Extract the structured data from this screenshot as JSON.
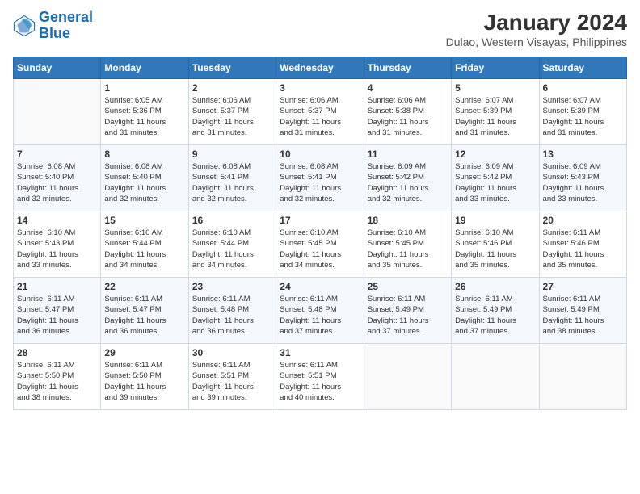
{
  "logo": {
    "line1": "General",
    "line2": "Blue"
  },
  "title": "January 2024",
  "subtitle": "Dulao, Western Visayas, Philippines",
  "weekdays": [
    "Sunday",
    "Monday",
    "Tuesday",
    "Wednesday",
    "Thursday",
    "Friday",
    "Saturday"
  ],
  "weeks": [
    [
      {
        "day": "",
        "info": ""
      },
      {
        "day": "1",
        "info": "Sunrise: 6:05 AM\nSunset: 5:36 PM\nDaylight: 11 hours\nand 31 minutes."
      },
      {
        "day": "2",
        "info": "Sunrise: 6:06 AM\nSunset: 5:37 PM\nDaylight: 11 hours\nand 31 minutes."
      },
      {
        "day": "3",
        "info": "Sunrise: 6:06 AM\nSunset: 5:37 PM\nDaylight: 11 hours\nand 31 minutes."
      },
      {
        "day": "4",
        "info": "Sunrise: 6:06 AM\nSunset: 5:38 PM\nDaylight: 11 hours\nand 31 minutes."
      },
      {
        "day": "5",
        "info": "Sunrise: 6:07 AM\nSunset: 5:39 PM\nDaylight: 11 hours\nand 31 minutes."
      },
      {
        "day": "6",
        "info": "Sunrise: 6:07 AM\nSunset: 5:39 PM\nDaylight: 11 hours\nand 31 minutes."
      }
    ],
    [
      {
        "day": "7",
        "info": "Sunrise: 6:08 AM\nSunset: 5:40 PM\nDaylight: 11 hours\nand 32 minutes."
      },
      {
        "day": "8",
        "info": "Sunrise: 6:08 AM\nSunset: 5:40 PM\nDaylight: 11 hours\nand 32 minutes."
      },
      {
        "day": "9",
        "info": "Sunrise: 6:08 AM\nSunset: 5:41 PM\nDaylight: 11 hours\nand 32 minutes."
      },
      {
        "day": "10",
        "info": "Sunrise: 6:08 AM\nSunset: 5:41 PM\nDaylight: 11 hours\nand 32 minutes."
      },
      {
        "day": "11",
        "info": "Sunrise: 6:09 AM\nSunset: 5:42 PM\nDaylight: 11 hours\nand 32 minutes."
      },
      {
        "day": "12",
        "info": "Sunrise: 6:09 AM\nSunset: 5:42 PM\nDaylight: 11 hours\nand 33 minutes."
      },
      {
        "day": "13",
        "info": "Sunrise: 6:09 AM\nSunset: 5:43 PM\nDaylight: 11 hours\nand 33 minutes."
      }
    ],
    [
      {
        "day": "14",
        "info": "Sunrise: 6:10 AM\nSunset: 5:43 PM\nDaylight: 11 hours\nand 33 minutes."
      },
      {
        "day": "15",
        "info": "Sunrise: 6:10 AM\nSunset: 5:44 PM\nDaylight: 11 hours\nand 34 minutes."
      },
      {
        "day": "16",
        "info": "Sunrise: 6:10 AM\nSunset: 5:44 PM\nDaylight: 11 hours\nand 34 minutes."
      },
      {
        "day": "17",
        "info": "Sunrise: 6:10 AM\nSunset: 5:45 PM\nDaylight: 11 hours\nand 34 minutes."
      },
      {
        "day": "18",
        "info": "Sunrise: 6:10 AM\nSunset: 5:45 PM\nDaylight: 11 hours\nand 35 minutes."
      },
      {
        "day": "19",
        "info": "Sunrise: 6:10 AM\nSunset: 5:46 PM\nDaylight: 11 hours\nand 35 minutes."
      },
      {
        "day": "20",
        "info": "Sunrise: 6:11 AM\nSunset: 5:46 PM\nDaylight: 11 hours\nand 35 minutes."
      }
    ],
    [
      {
        "day": "21",
        "info": "Sunrise: 6:11 AM\nSunset: 5:47 PM\nDaylight: 11 hours\nand 36 minutes."
      },
      {
        "day": "22",
        "info": "Sunrise: 6:11 AM\nSunset: 5:47 PM\nDaylight: 11 hours\nand 36 minutes."
      },
      {
        "day": "23",
        "info": "Sunrise: 6:11 AM\nSunset: 5:48 PM\nDaylight: 11 hours\nand 36 minutes."
      },
      {
        "day": "24",
        "info": "Sunrise: 6:11 AM\nSunset: 5:48 PM\nDaylight: 11 hours\nand 37 minutes."
      },
      {
        "day": "25",
        "info": "Sunrise: 6:11 AM\nSunset: 5:49 PM\nDaylight: 11 hours\nand 37 minutes."
      },
      {
        "day": "26",
        "info": "Sunrise: 6:11 AM\nSunset: 5:49 PM\nDaylight: 11 hours\nand 37 minutes."
      },
      {
        "day": "27",
        "info": "Sunrise: 6:11 AM\nSunset: 5:49 PM\nDaylight: 11 hours\nand 38 minutes."
      }
    ],
    [
      {
        "day": "28",
        "info": "Sunrise: 6:11 AM\nSunset: 5:50 PM\nDaylight: 11 hours\nand 38 minutes."
      },
      {
        "day": "29",
        "info": "Sunrise: 6:11 AM\nSunset: 5:50 PM\nDaylight: 11 hours\nand 39 minutes."
      },
      {
        "day": "30",
        "info": "Sunrise: 6:11 AM\nSunset: 5:51 PM\nDaylight: 11 hours\nand 39 minutes."
      },
      {
        "day": "31",
        "info": "Sunrise: 6:11 AM\nSunset: 5:51 PM\nDaylight: 11 hours\nand 40 minutes."
      },
      {
        "day": "",
        "info": ""
      },
      {
        "day": "",
        "info": ""
      },
      {
        "day": "",
        "info": ""
      }
    ]
  ]
}
